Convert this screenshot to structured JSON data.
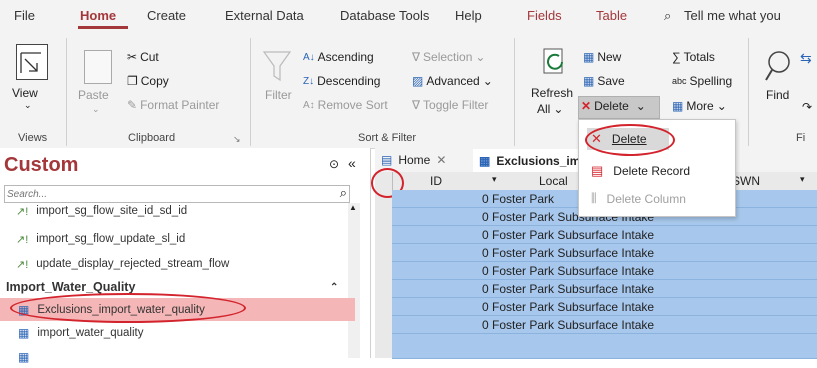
{
  "menu": {
    "file": "File",
    "home": "Home",
    "create": "Create",
    "external_data": "External Data",
    "database_tools": "Database Tools",
    "help": "Help",
    "fields": "Fields",
    "table": "Table",
    "tell_me": "Tell me what you"
  },
  "ribbon": {
    "views": {
      "view_label": "View",
      "group_label": "Views"
    },
    "clipboard": {
      "paste": "Paste",
      "cut": "Cut",
      "copy": "Copy",
      "format_painter": "Format Painter",
      "group_label": "Clipboard"
    },
    "sort_filter": {
      "filter": "Filter",
      "ascending": "Ascending",
      "descending": "Descending",
      "remove_sort": "Remove Sort",
      "selection": "Selection",
      "advanced": "Advanced",
      "toggle_filter": "Toggle Filter",
      "group_label": "Sort & Filter"
    },
    "records": {
      "refresh": "Refresh",
      "refresh_sub": "All",
      "new": "New",
      "save": "Save",
      "delete": "Delete",
      "totals": "Totals",
      "spelling": "Spelling",
      "more": "More"
    },
    "find": {
      "find": "Find",
      "group_label": "Fi"
    }
  },
  "delete_menu": {
    "delete": "Delete",
    "delete_record": "Delete Record",
    "delete_column": "Delete Column"
  },
  "nav": {
    "title": "Custom",
    "search_placeholder": "Search...",
    "items_top": [
      "import_sg_flow_site_id_sd_id",
      "import_sg_flow_update_sl_id",
      "update_display_rejected_stream_flow"
    ],
    "group_header": "Import_Water_Quality",
    "items_group": [
      "Exclusions_import_water_quality",
      "import_water_quality"
    ]
  },
  "tabs": {
    "home": "Home",
    "active": "Exclusions_im"
  },
  "grid": {
    "headers": {
      "id": "ID",
      "local": "Local",
      "swn": "SWN"
    },
    "rows": [
      {
        "id": "0",
        "local": "Foster Park"
      },
      {
        "id": "0",
        "local": "Foster Park Subsurface Intake"
      },
      {
        "id": "0",
        "local": "Foster Park Subsurface Intake"
      },
      {
        "id": "0",
        "local": "Foster Park Subsurface Intake"
      },
      {
        "id": "0",
        "local": "Foster Park Subsurface Intake"
      },
      {
        "id": "0",
        "local": "Foster Park Subsurface Intake"
      },
      {
        "id": "0",
        "local": "Foster Park Subsurface Intake"
      },
      {
        "id": "0",
        "local": "Foster Park Subsurface Intake"
      }
    ]
  },
  "colors": {
    "accent": "#a4373a",
    "selection": "#a7c7ec",
    "annotation": "#d3232c",
    "nav_selected": "#f4b6b6"
  }
}
